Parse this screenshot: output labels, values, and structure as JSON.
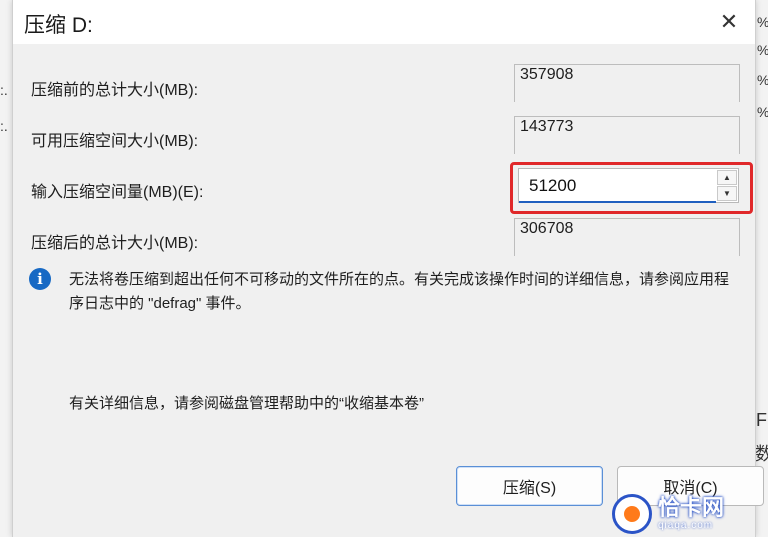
{
  "background": {
    "right_fragments": [
      "%",
      "%",
      "%",
      "%",
      "F",
      "数"
    ],
    "left_fragments": [
      ":.",
      ":."
    ]
  },
  "dialog": {
    "title": "压缩 D:",
    "close_glyph": "✕",
    "fields": [
      {
        "label": "压缩前的总计大小(MB):",
        "value": "357908"
      },
      {
        "label": "可用压缩空间大小(MB):",
        "value": "143773"
      },
      {
        "label": "输入压缩空间量(MB)(E):",
        "value": "51200"
      },
      {
        "label": "压缩后的总计大小(MB):",
        "value": "306708"
      }
    ],
    "spin_up_glyph": "▲",
    "spin_down_glyph": "▼",
    "info_icon_glyph": "i",
    "info_message": "无法将卷压缩到超出任何不可移动的文件所在的点。有关完成该操作时间的详细信息，请参阅应用程序日志中的 \"defrag\" 事件。",
    "help_message": "有关详细信息，请参阅磁盘管理帮助中的“收缩基本卷”",
    "buttons": {
      "shrink": "压缩(S)",
      "cancel": "取消(C)"
    },
    "highlight_color": "#e0282a"
  },
  "watermark": {
    "title": "恰卡网",
    "url": "qiaqa.com"
  }
}
